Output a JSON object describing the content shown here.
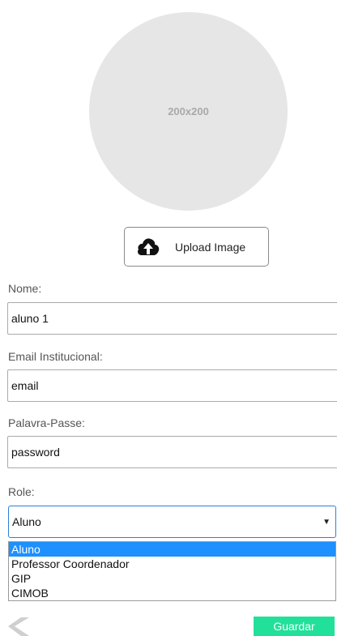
{
  "avatar": {
    "placeholder_text": "200x200"
  },
  "upload": {
    "label": "Upload Image",
    "icon": "cloud-upload-icon"
  },
  "form": {
    "nome": {
      "label": "Nome:",
      "value": "aluno 1"
    },
    "email": {
      "label": "Email Institucional:",
      "value": "email"
    },
    "password": {
      "label": "Palavra-Passe:",
      "value": "password"
    },
    "role": {
      "label": "Role:",
      "selected": "Aluno",
      "options": [
        "Aluno",
        "Professor Coordenador",
        "GIP",
        "CIMOB"
      ]
    }
  },
  "actions": {
    "save_label": "Guardar",
    "back_icon": "chevron-left-icon"
  },
  "colors": {
    "save_button": "#21e09a",
    "selected_option": "#1e90ff",
    "avatar_bg": "#e6e6e6"
  }
}
